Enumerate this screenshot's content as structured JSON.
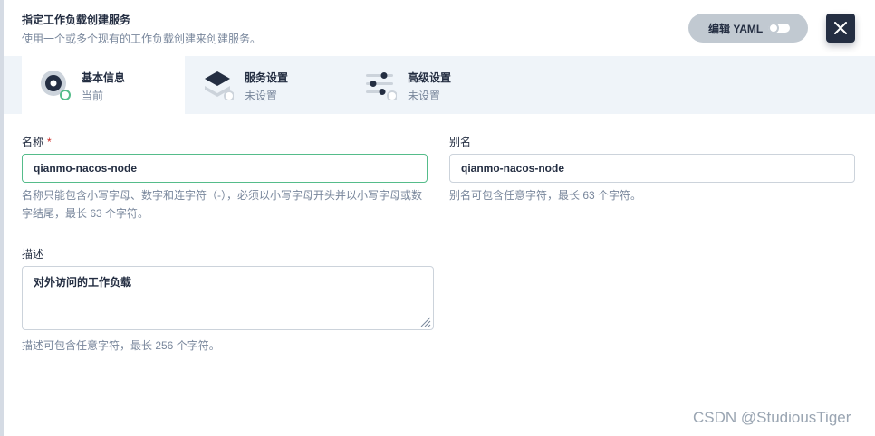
{
  "header": {
    "title": "指定工作负载创建服务",
    "description": "使用一个或多个现有的工作负载创建来创建服务。",
    "yaml_label": "编辑 YAML"
  },
  "steps": [
    {
      "title": "基本信息",
      "status": "当前",
      "icon": "basic-info-icon"
    },
    {
      "title": "服务设置",
      "status": "未设置",
      "icon": "layers-icon"
    },
    {
      "title": "高级设置",
      "status": "未设置",
      "icon": "sliders-icon"
    }
  ],
  "form": {
    "name": {
      "label": "名称",
      "required_mark": "*",
      "value": "qianmo-nacos-node",
      "hint": "名称只能包含小写字母、数字和连字符（-），必须以小写字母开头并以小写字母或数字结尾，最长 63 个字符。"
    },
    "alias": {
      "label": "别名",
      "value": "qianmo-nacos-node",
      "hint": "别名可包含任意字符，最长 63 个字符。"
    },
    "description": {
      "label": "描述",
      "value": "对外访问的工作负载",
      "hint": "描述可包含任意字符，最长 256 个字符。"
    }
  },
  "watermark": "CSDN @StudiousTiger",
  "colors": {
    "accent_green": "#55bc8a",
    "dark": "#242e42",
    "muted": "#79879c",
    "steps_bg": "#eff4f9"
  }
}
